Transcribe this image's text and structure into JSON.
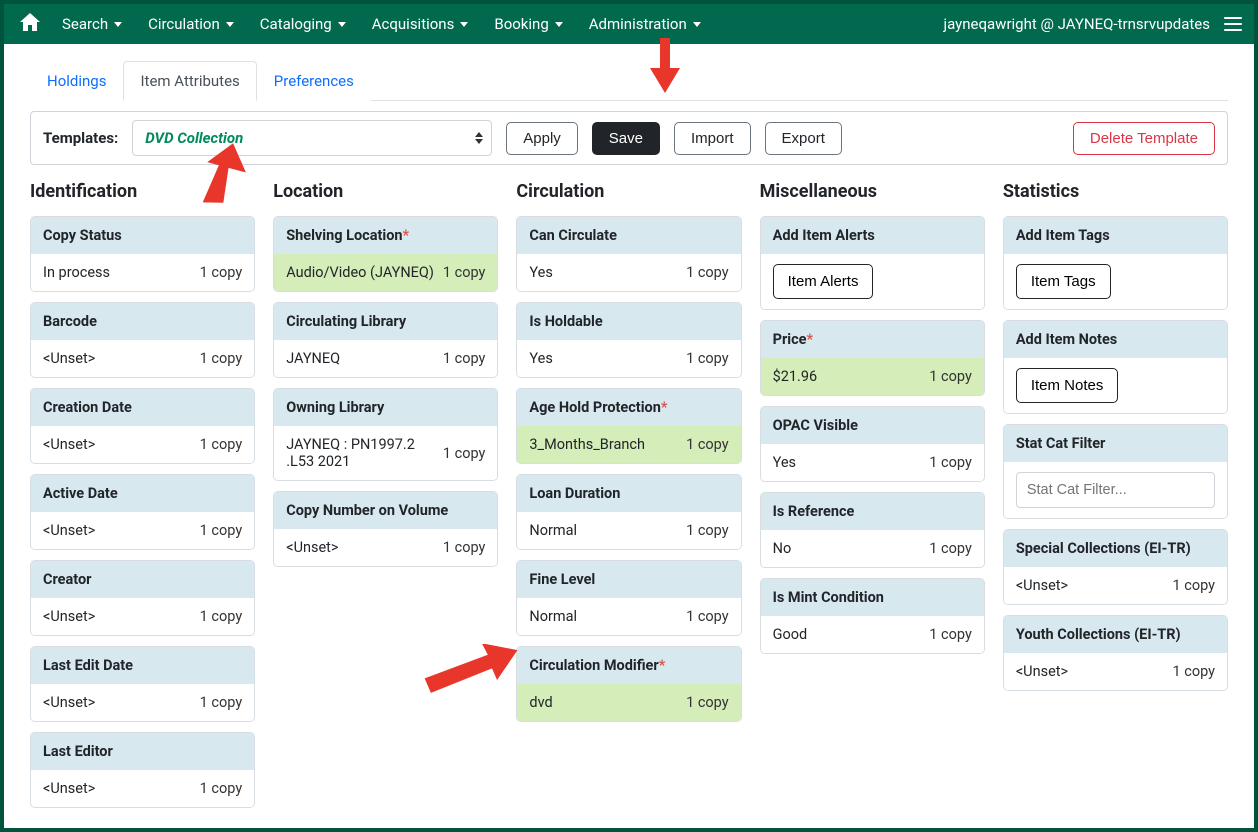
{
  "nav": {
    "items": [
      "Search",
      "Circulation",
      "Cataloging",
      "Acquisitions",
      "Booking",
      "Administration"
    ],
    "user_label": "jayneqawright @ JAYNEQ-trnsrvupdates"
  },
  "tabs": {
    "holdings": "Holdings",
    "item_attributes": "Item Attributes",
    "preferences": "Preferences"
  },
  "templates": {
    "label": "Templates:",
    "value": "DVD Collection",
    "apply": "Apply",
    "save": "Save",
    "import": "Import",
    "export": "Export",
    "delete": "Delete Template"
  },
  "count_label": "1 copy",
  "unset": "<Unset>",
  "sections": {
    "identification": {
      "title": "Identification",
      "fields": {
        "copy_status": {
          "label": "Copy Status",
          "value": "In process"
        },
        "barcode": {
          "label": "Barcode"
        },
        "creation_date": {
          "label": "Creation Date"
        },
        "active_date": {
          "label": "Active Date"
        },
        "creator": {
          "label": "Creator"
        },
        "last_edit_date": {
          "label": "Last Edit Date"
        },
        "last_editor": {
          "label": "Last Editor"
        }
      }
    },
    "location": {
      "title": "Location",
      "fields": {
        "shelving_location": {
          "label": "Shelving Location",
          "value": "Audio/Video (JAYNEQ)",
          "required": true,
          "green": true
        },
        "circ_library": {
          "label": "Circulating Library",
          "value": "JAYNEQ"
        },
        "owning_library": {
          "label": "Owning Library",
          "value": "JAYNEQ : PN1997.2 .L53 2021"
        },
        "copy_number": {
          "label": "Copy Number on Volume"
        }
      }
    },
    "circulation": {
      "title": "Circulation",
      "fields": {
        "can_circulate": {
          "label": "Can Circulate",
          "value": "Yes"
        },
        "is_holdable": {
          "label": "Is Holdable",
          "value": "Yes"
        },
        "age_hold": {
          "label": "Age Hold Protection",
          "value": "3_Months_Branch",
          "required": true,
          "green": true
        },
        "loan_duration": {
          "label": "Loan Duration",
          "value": "Normal"
        },
        "fine_level": {
          "label": "Fine Level",
          "value": "Normal"
        },
        "circ_modifier": {
          "label": "Circulation Modifier",
          "value": "dvd",
          "required": true,
          "green": true
        }
      }
    },
    "misc": {
      "title": "Miscellaneous",
      "fields": {
        "add_item_alerts": {
          "label": "Add Item Alerts",
          "button": "Item Alerts"
        },
        "price": {
          "label": "Price",
          "value": "$21.96",
          "required": true,
          "green": true
        },
        "opac_visible": {
          "label": "OPAC Visible",
          "value": "Yes"
        },
        "is_reference": {
          "label": "Is Reference",
          "value": "No"
        },
        "is_mint": {
          "label": "Is Mint Condition",
          "value": "Good"
        }
      }
    },
    "stats": {
      "title": "Statistics",
      "fields": {
        "add_item_tags": {
          "label": "Add Item Tags",
          "button": "Item Tags"
        },
        "add_item_notes": {
          "label": "Add Item Notes",
          "button": "Item Notes"
        },
        "stat_cat_filter": {
          "label": "Stat Cat Filter",
          "placeholder": "Stat Cat Filter..."
        },
        "special_collections": {
          "label": "Special Collections (EI-TR)"
        },
        "youth_collections": {
          "label": "Youth Collections (EI-TR)"
        }
      }
    }
  }
}
